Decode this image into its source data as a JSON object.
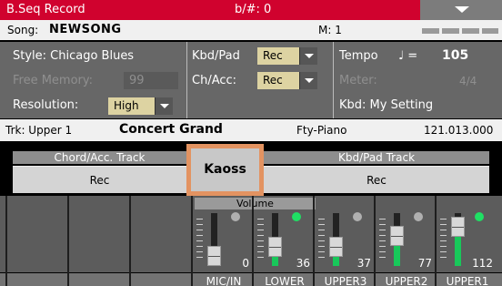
{
  "titlebar": {
    "title": "B.Seq Record",
    "accidental": "b/#: 0",
    "bg": "#d0022e"
  },
  "song": {
    "label": "Song:",
    "name": "NEWSONG",
    "measure": "M: 1"
  },
  "panel": {
    "style": "Style: Chicago Blues",
    "free_memory_label": "Free Memory:",
    "free_memory_value": "99",
    "resolution_label": "Resolution:",
    "resolution_value": "High",
    "kbd_pad_label": "Kbd/Pad",
    "kbd_pad_value": "Rec",
    "ch_acc_label": "Ch/Acc:",
    "ch_acc_value": "Rec",
    "tempo_label": "Tempo",
    "tempo_note": "♩ =",
    "tempo_value": "105",
    "meter_label": "Meter:",
    "meter_value": "4/4",
    "kbd_setting": "Kbd: My Setting"
  },
  "track": {
    "trk": "Trk: Upper 1",
    "sound": "Concert Grand",
    "category": "Fty-Piano",
    "number": "121.013.000"
  },
  "kaoss": {
    "label": "Kaoss",
    "accent": "#e39361"
  },
  "chord_acc": {
    "header": "Chord/Acc. Track",
    "value": "Rec"
  },
  "kbd_pad_track": {
    "header": "Kbd/Pad Track",
    "value": "Rec"
  },
  "mixer": {
    "volume_header": "Volume",
    "channels": [
      {
        "name": "MIC/IN",
        "value": "0",
        "level": 0.0,
        "led": "off"
      },
      {
        "name": "LOWER",
        "value": "36",
        "level": 0.28,
        "led": "on"
      },
      {
        "name": "UPPER3",
        "value": "37",
        "level": 0.29,
        "led": "off"
      },
      {
        "name": "UPPER2",
        "value": "77",
        "level": 0.61,
        "led": "off"
      },
      {
        "name": "UPPER1",
        "value": "112",
        "level": 0.88,
        "led": "on"
      }
    ],
    "led_on_color": "#1fe064"
  }
}
